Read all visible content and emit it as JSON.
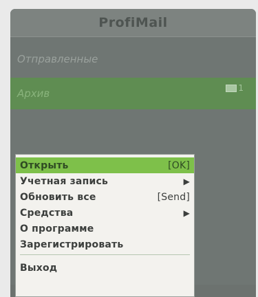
{
  "app": {
    "title": "ProfiMail"
  },
  "folders": [
    {
      "name": "Отправленные",
      "count": ""
    },
    {
      "name": "Архив",
      "count": "1"
    }
  ],
  "menu": {
    "items": [
      {
        "label": "Открыть",
        "hint": "[OK]",
        "active": true,
        "submenu": false
      },
      {
        "label": "Учетная запись",
        "hint": "",
        "active": false,
        "submenu": true
      },
      {
        "label": "Обновить все",
        "hint": "[Send]",
        "active": false,
        "submenu": false
      },
      {
        "label": "Средства",
        "hint": "",
        "active": false,
        "submenu": true
      },
      {
        "label": "О программе",
        "hint": "",
        "active": false,
        "submenu": false
      },
      {
        "label": "Зарегистрировать",
        "hint": "",
        "active": false,
        "submenu": false
      },
      {
        "label": "Выход",
        "hint": "",
        "active": false,
        "submenu": false
      }
    ]
  }
}
